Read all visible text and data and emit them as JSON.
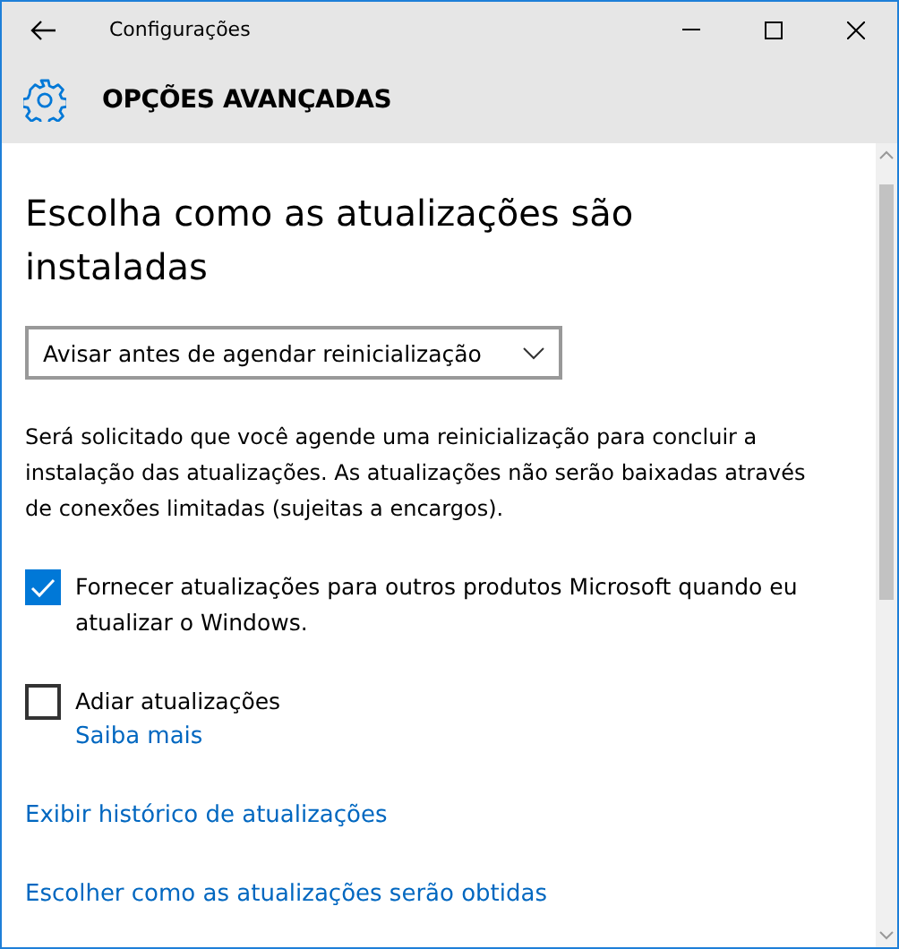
{
  "window": {
    "title": "Configurações"
  },
  "header": {
    "title": "OPÇÕES AVANÇADAS"
  },
  "heading": "Escolha como as atualizações são instaladas",
  "dropdown": {
    "value": "Avisar antes de agendar reinicialização"
  },
  "description": "Será solicitado que você agende uma reinicialização para concluir a instalação das atualizações. As atualizações não serão baixadas através de conexões limitadas (sujeitas a encargos).",
  "options": [
    {
      "label": "Fornecer atualizações para outros produtos Microsoft quando eu atualizar o Windows.",
      "checked": true
    },
    {
      "label": "Adiar atualizações",
      "checked": false,
      "link": "Saiba mais"
    }
  ],
  "links": [
    "Exibir histórico de atualizações",
    "Escolher como as atualizações serão obtidas"
  ]
}
